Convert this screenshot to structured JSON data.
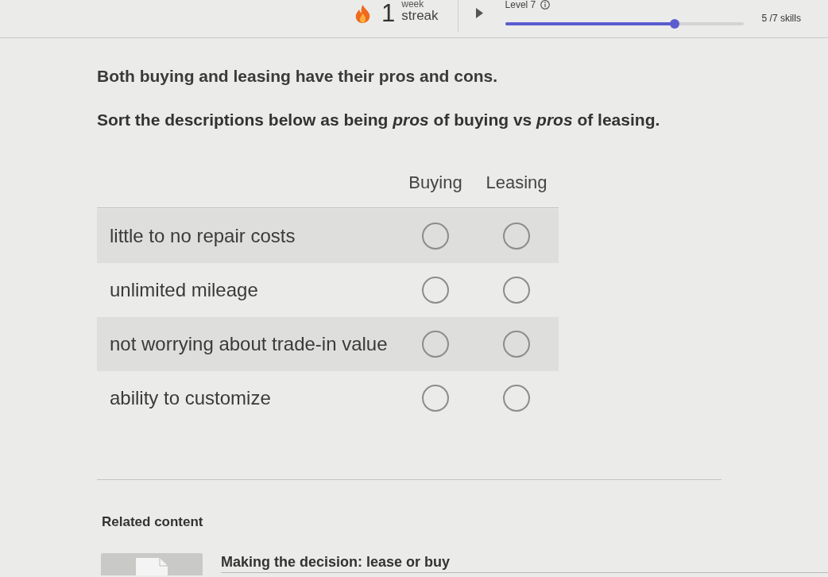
{
  "header": {
    "streak": {
      "count": "1",
      "unit": "week",
      "label": "streak"
    },
    "level": {
      "label": "Level 7",
      "progress": {
        "level": 0.71
      },
      "skills": "5 /7 skills"
    }
  },
  "intro": "Both buying and leasing have their pros and cons.",
  "instruction": "Sort the descriptions below as being *pros* of buying vs *pros* of leasing.",
  "table": {
    "columns": [
      "Buying",
      "Leasing"
    ],
    "rows": [
      {
        "label": "little to no repair costs",
        "options": [
          {
            "selected": false
          },
          {
            "selected": false
          }
        ]
      },
      {
        "label": "unlimited mileage",
        "options": [
          {
            "selected": false
          },
          {
            "selected": false
          }
        ]
      },
      {
        "label": "not worrying about trade-in value",
        "options": [
          {
            "selected": false
          },
          {
            "selected": false
          }
        ]
      },
      {
        "label": "ability to customize",
        "options": [
          {
            "selected": false
          },
          {
            "selected": false
          }
        ]
      }
    ]
  },
  "related": {
    "heading": "Related content",
    "items": [
      {
        "title": "Making the decision: lease or buy"
      }
    ]
  }
}
